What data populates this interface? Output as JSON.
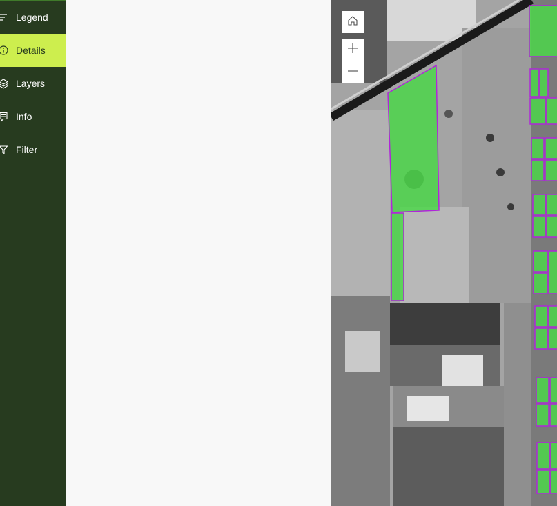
{
  "sidebar": {
    "items": [
      {
        "id": "legend",
        "label": "Legend",
        "icon": "legend-icon",
        "active": false
      },
      {
        "id": "details",
        "label": "Details",
        "icon": "info-circle-icon",
        "active": true
      },
      {
        "id": "layers",
        "label": "Layers",
        "icon": "layers-icon",
        "active": false
      },
      {
        "id": "info",
        "label": "Info",
        "icon": "info-board-icon",
        "active": false
      },
      {
        "id": "filter",
        "label": "Filter",
        "icon": "filter-icon",
        "active": false
      }
    ]
  },
  "map": {
    "controls": [
      {
        "id": "home",
        "icon": "home-icon"
      },
      {
        "id": "zoom_in",
        "icon": "plus-icon"
      },
      {
        "id": "zoom_out",
        "icon": "minus-icon"
      }
    ]
  },
  "colors": {
    "sidebar_bg": "#273b1f",
    "active_bg": "#cdee4e",
    "parcel_fill": "#4cd64a",
    "parcel_outline": "#b026d9",
    "panel_bg": "#f8f8f8"
  }
}
